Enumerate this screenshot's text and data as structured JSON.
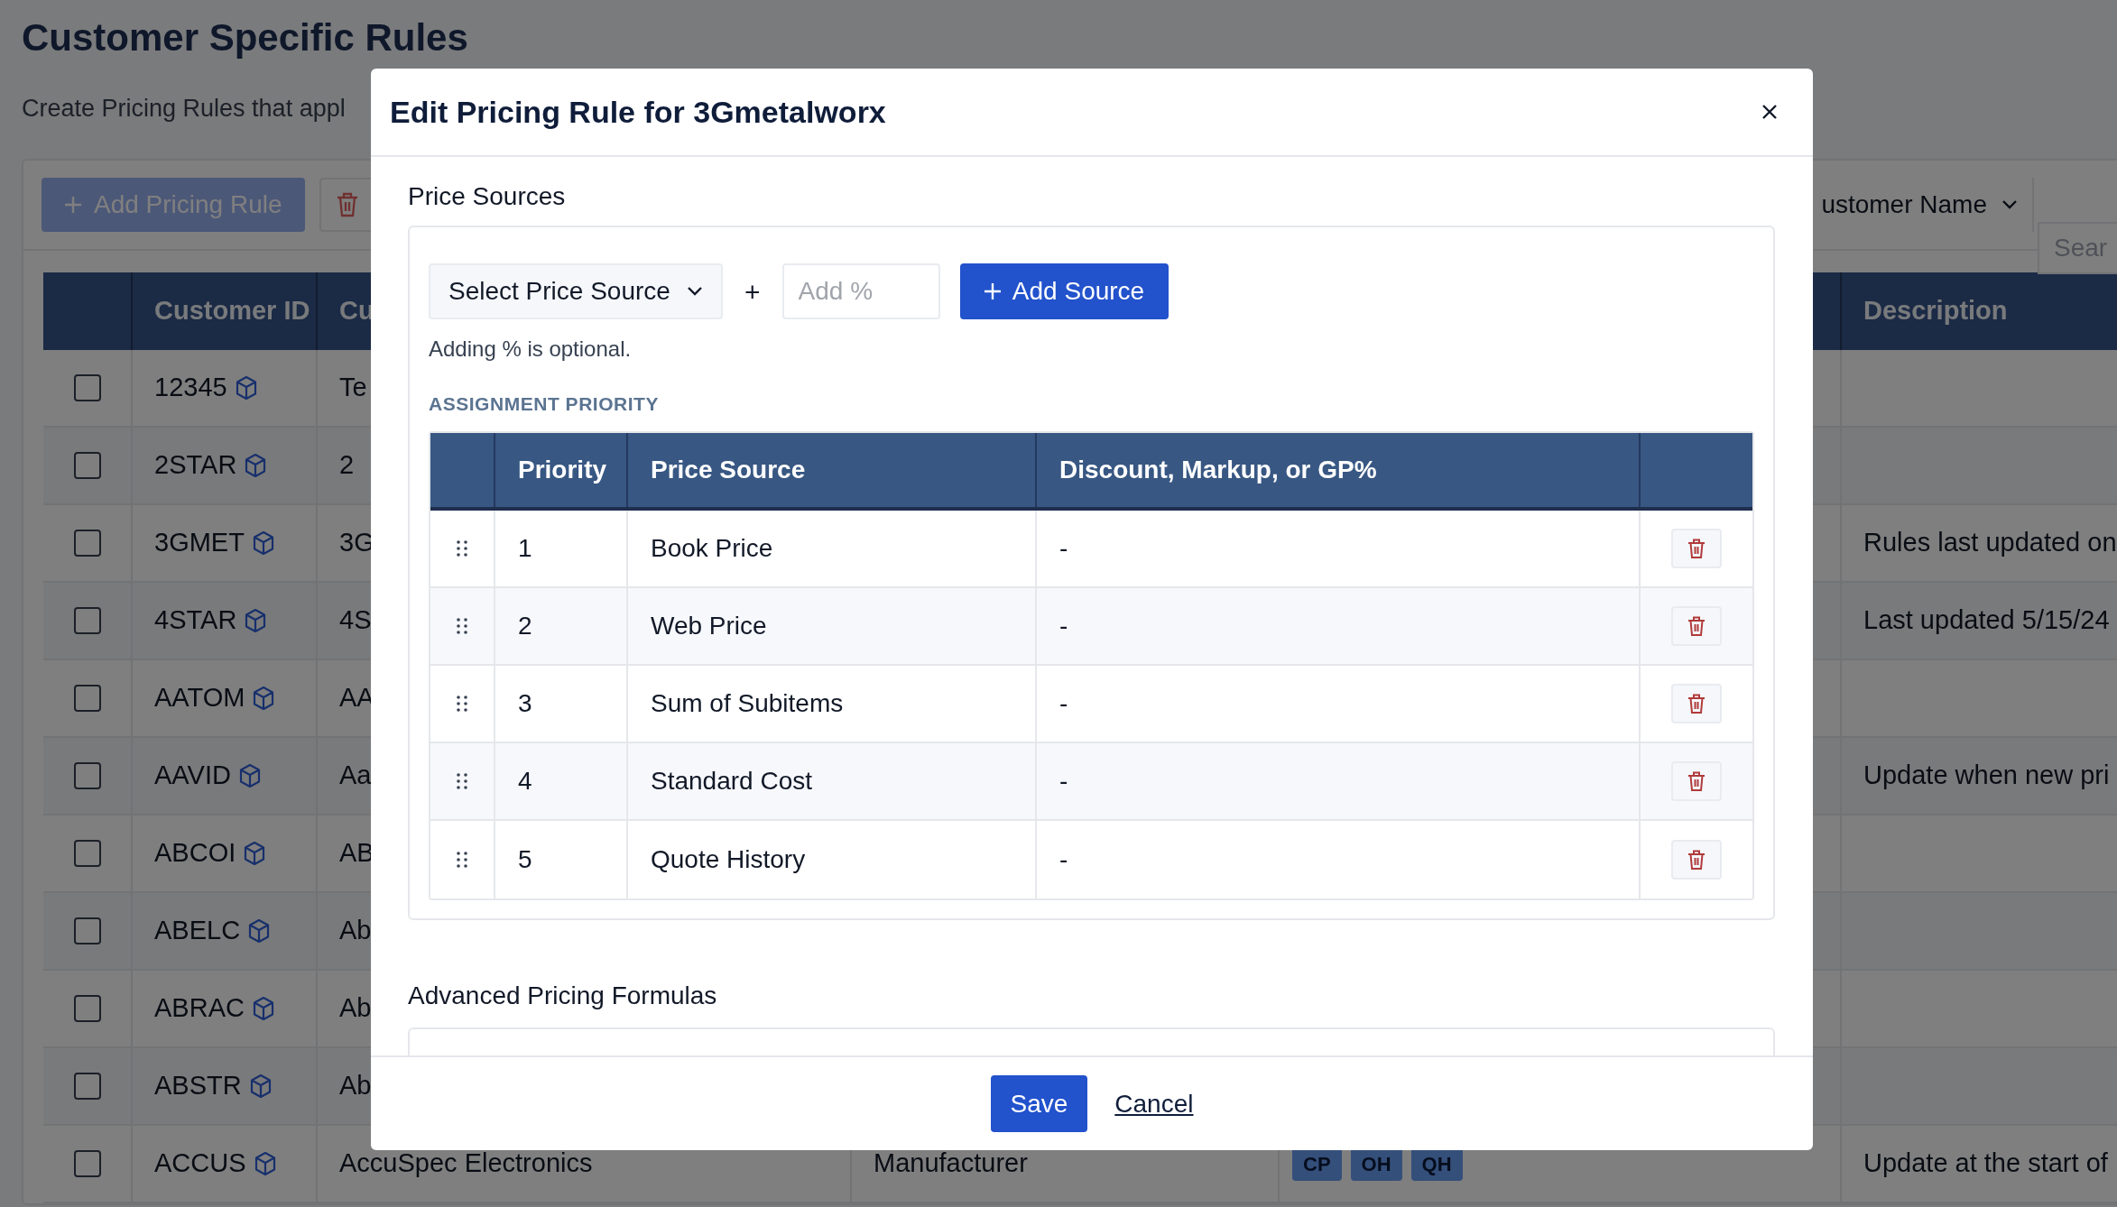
{
  "page": {
    "title": "Customer Specific Rules",
    "subtitle": "Create Pricing Rules that appl",
    "toolbar": {
      "add_button": "Add Pricing Rule",
      "filter_dropdown": "ustomer Name",
      "search_placeholder": "Sear"
    },
    "columns": {
      "customer_id": "Customer ID",
      "column_3": "Cu",
      "description": "Description"
    },
    "rows": [
      {
        "checked": false,
        "customer_id": "12345",
        "column_3": "Te"
      },
      {
        "checked": false,
        "customer_id": "2STAR",
        "column_3": "2"
      },
      {
        "checked": false,
        "customer_id": "3GMET",
        "column_3": "3G",
        "description": "Rules last updated on"
      },
      {
        "checked": false,
        "customer_id": "4STAR",
        "column_3": "4S",
        "description": "Last updated 5/15/24"
      },
      {
        "checked": false,
        "customer_id": "AATOM",
        "column_3": "AA"
      },
      {
        "checked": false,
        "customer_id": "AAVID",
        "column_3": "Aa",
        "description": "Update when new pri"
      },
      {
        "checked": false,
        "customer_id": "ABCOI",
        "column_3": "AB"
      },
      {
        "checked": false,
        "customer_id": "ABELC",
        "column_3": "Ab"
      },
      {
        "checked": false,
        "customer_id": "ABRAC",
        "column_3": "Ab"
      },
      {
        "checked": false,
        "customer_id": "ABSTR",
        "column_3": "Ab"
      },
      {
        "checked": false,
        "customer_id": "ACCUS",
        "column_3": "AccuSpec Electronics",
        "column_4": "Manufacturer",
        "tags": [
          "CP",
          "OH",
          "QH"
        ],
        "description": "Update at the start of"
      }
    ]
  },
  "dialog": {
    "title": "Edit Pricing Rule for 3Gmetalworx",
    "price_sources": {
      "label": "Price Sources",
      "select": "Select Price Source",
      "plus": "+",
      "percent_placeholder": "Add %",
      "add_button": "Add Source",
      "hint": "Adding % is optional.",
      "priority_heading": "ASSIGNMENT PRIORITY",
      "columns": [
        "Priority",
        "Price Source",
        "Discount, Markup, or GP%"
      ],
      "rows": [
        {
          "priority": "1",
          "source": "Book Price",
          "adjustment": "-"
        },
        {
          "priority": "2",
          "source": "Web Price",
          "adjustment": "-"
        },
        {
          "priority": "3",
          "source": "Sum of Subitems",
          "adjustment": "-"
        },
        {
          "priority": "4",
          "source": "Standard Cost",
          "adjustment": "-"
        },
        {
          "priority": "5",
          "source": "Quote History",
          "adjustment": "-"
        }
      ]
    },
    "advanced_label": "Advanced Pricing Formulas",
    "footer": {
      "save": "Save",
      "cancel": "Cancel"
    }
  }
}
